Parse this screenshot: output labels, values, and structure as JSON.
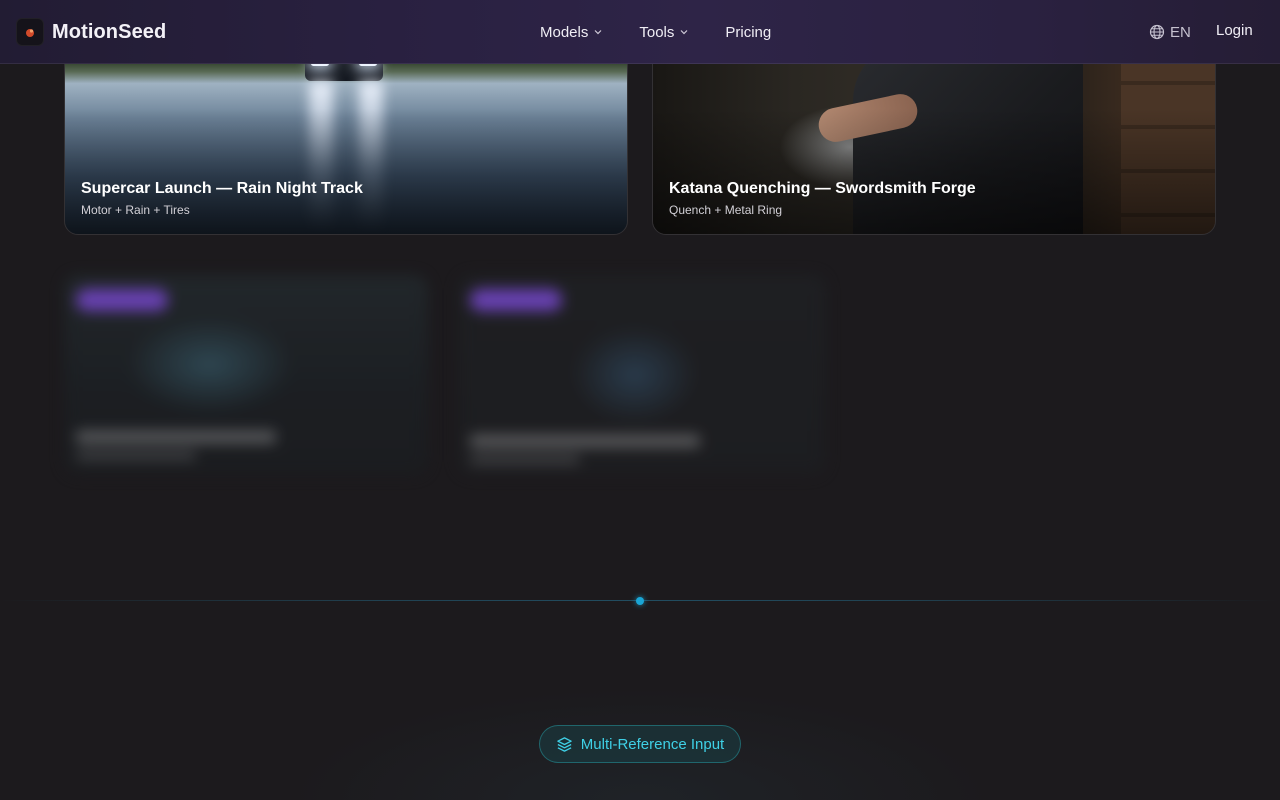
{
  "nav": {
    "brand": "MotionSeed",
    "links": [
      {
        "label": "Models",
        "dropdown": true
      },
      {
        "label": "Tools",
        "dropdown": true
      },
      {
        "label": "Pricing",
        "dropdown": false
      }
    ],
    "language": "EN",
    "login": "Login"
  },
  "cards": [
    {
      "title": "Supercar Launch — Rain Night Track",
      "subtitle": "Motor + Rain + Tires"
    },
    {
      "title": "Katana Quenching — Swordsmith Forge",
      "subtitle": "Quench + Metal Ring"
    }
  ],
  "section_badge": {
    "label": "Multi-Reference Input",
    "icon": "layers-icon",
    "color": "#3fd0e6"
  },
  "colors": {
    "accent": "#1aa6d6",
    "nav_bg": "#2a2142",
    "page_bg": "#1c1a1d"
  }
}
